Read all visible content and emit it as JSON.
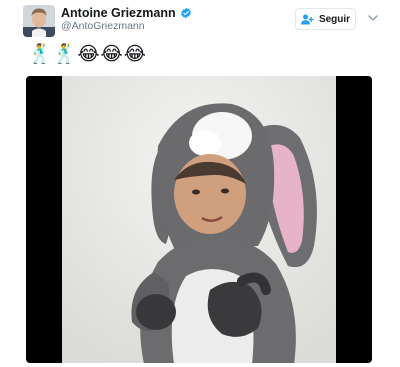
{
  "tweet": {
    "author": {
      "display_name": "Antoine Griezmann",
      "handle": "@AntoGriezmann",
      "verified": true,
      "avatar_icon": "profile-photo"
    },
    "follow_button": {
      "label": "Seguir",
      "icon": "person-add-icon"
    },
    "menu_icon": "chevron-down-icon",
    "text": "🕺🕺😂😂😂",
    "media": {
      "type": "video",
      "description_icon": "video-thumbnail"
    },
    "colors": {
      "accent": "#1da1f2",
      "text": "#14171a",
      "muted": "#657786",
      "border": "#e1e8ed",
      "media_bg": "#000000"
    }
  }
}
